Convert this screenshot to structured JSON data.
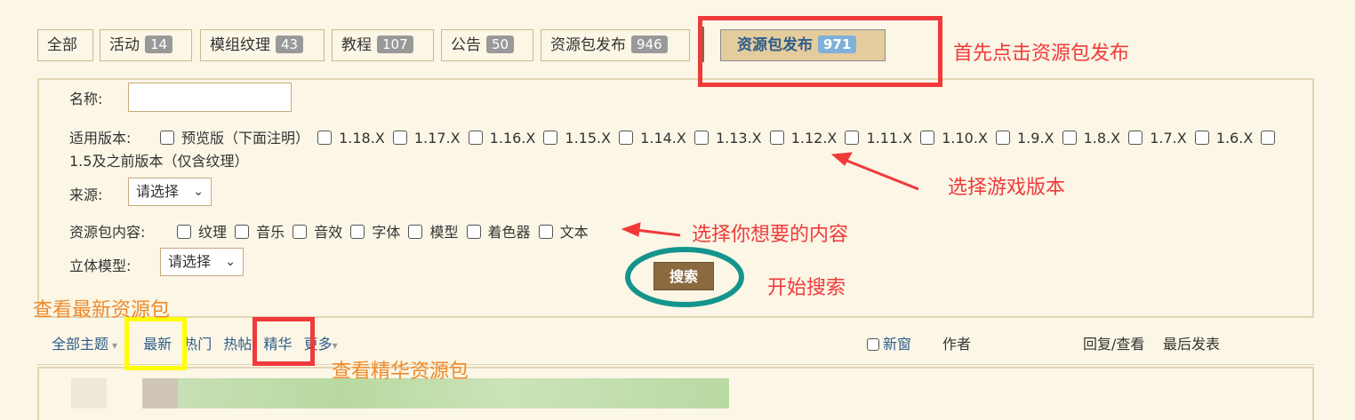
{
  "tabs": [
    {
      "label": "全部",
      "count": ""
    },
    {
      "label": "活动",
      "count": "14"
    },
    {
      "label": "模组纹理",
      "count": "43"
    },
    {
      "label": "教程",
      "count": "107"
    },
    {
      "label": "公告",
      "count": "50"
    },
    {
      "label": "资源包发布",
      "count": "946"
    },
    {
      "label": "资源包发布",
      "count": "971"
    }
  ],
  "filter": {
    "name_label": "名称:",
    "version_label": "适用版本:",
    "versions": [
      "预览版（下面注明）",
      "1.18.X",
      "1.17.X",
      "1.16.X",
      "1.15.X",
      "1.14.X",
      "1.13.X",
      "1.12.X",
      "1.11.X",
      "1.10.X",
      "1.9.X",
      "1.8.X",
      "1.7.X",
      "1.6.X"
    ],
    "versions_row2": "1.5及之前版本（仅含纹理）",
    "source_label": "来源:",
    "source_value": "请选择",
    "content_label": "资源包内容:",
    "contents": [
      "纹理",
      "音乐",
      "音效",
      "字体",
      "模型",
      "着色器",
      "文本"
    ],
    "model_label": "立体模型:",
    "model_value": "请选择",
    "search_button": "搜索"
  },
  "list_header": {
    "all_topics": "全部主题",
    "latest": "最新",
    "hot": "热门",
    "hot_posts": "热帖",
    "featured": "精华",
    "more": "更多",
    "new_window": "新窗",
    "author": "作者",
    "reply_view": "回复/查看",
    "last_post": "最后发表"
  },
  "annotations": {
    "click_first": "首先点击资源包发布",
    "choose_version": "选择游戏版本",
    "choose_content": "选择你想要的内容",
    "start_search": "开始搜索",
    "view_latest": "查看最新资源包",
    "view_featured": "查看精华资源包"
  },
  "colors": {
    "annotation_red": "#f03a3a",
    "annotation_orange": "#f08a2c",
    "annotation_yellow": "#ffff00",
    "annotation_teal": "#14948c",
    "link_blue": "#2e5c8a"
  }
}
